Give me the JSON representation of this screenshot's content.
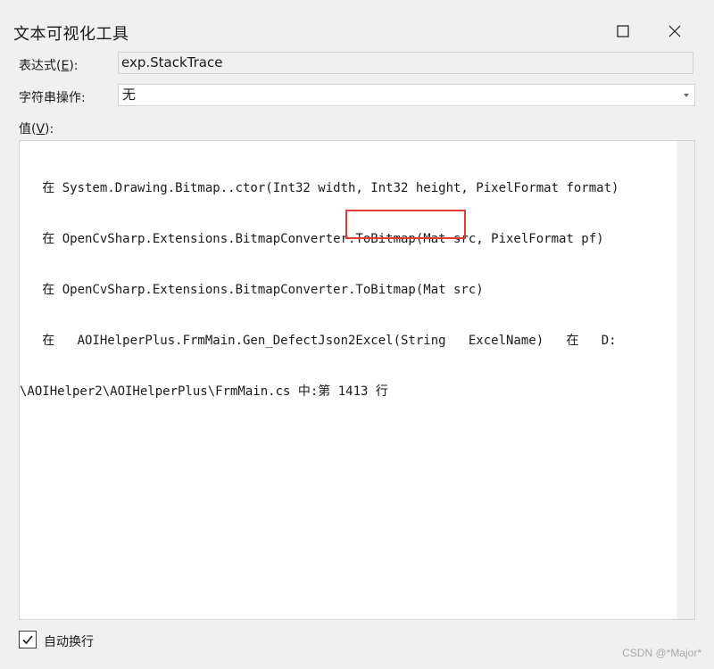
{
  "window": {
    "title": "文本可视化工具"
  },
  "expression": {
    "label_prefix": "表达式(",
    "label_key": "E",
    "label_suffix": "):",
    "value": "exp.StackTrace"
  },
  "string_operation": {
    "label": "字符串操作:",
    "selected": "无"
  },
  "value_section": {
    "label_prefix": "值(",
    "label_key": "V",
    "label_suffix": "):",
    "lines": [
      "   在 System.Drawing.Bitmap..ctor(Int32 width, Int32 height, PixelFormat format)",
      "   在 OpenCvSharp.Extensions.BitmapConverter.ToBitmap(Mat src, PixelFormat pf)",
      "   在 OpenCvSharp.Extensions.BitmapConverter.ToBitmap(Mat src)",
      "   在   AOIHelperPlus.FrmMain.Gen_DefectJson2Excel(String   ExcelName)   在   D:",
      "\\AOIHelper2\\AOIHelperPlus\\FrmMain.cs 中:第 1413 行"
    ]
  },
  "word_wrap": {
    "label": "自动换行",
    "checked": true
  },
  "watermark": "CSDN @*Major*"
}
